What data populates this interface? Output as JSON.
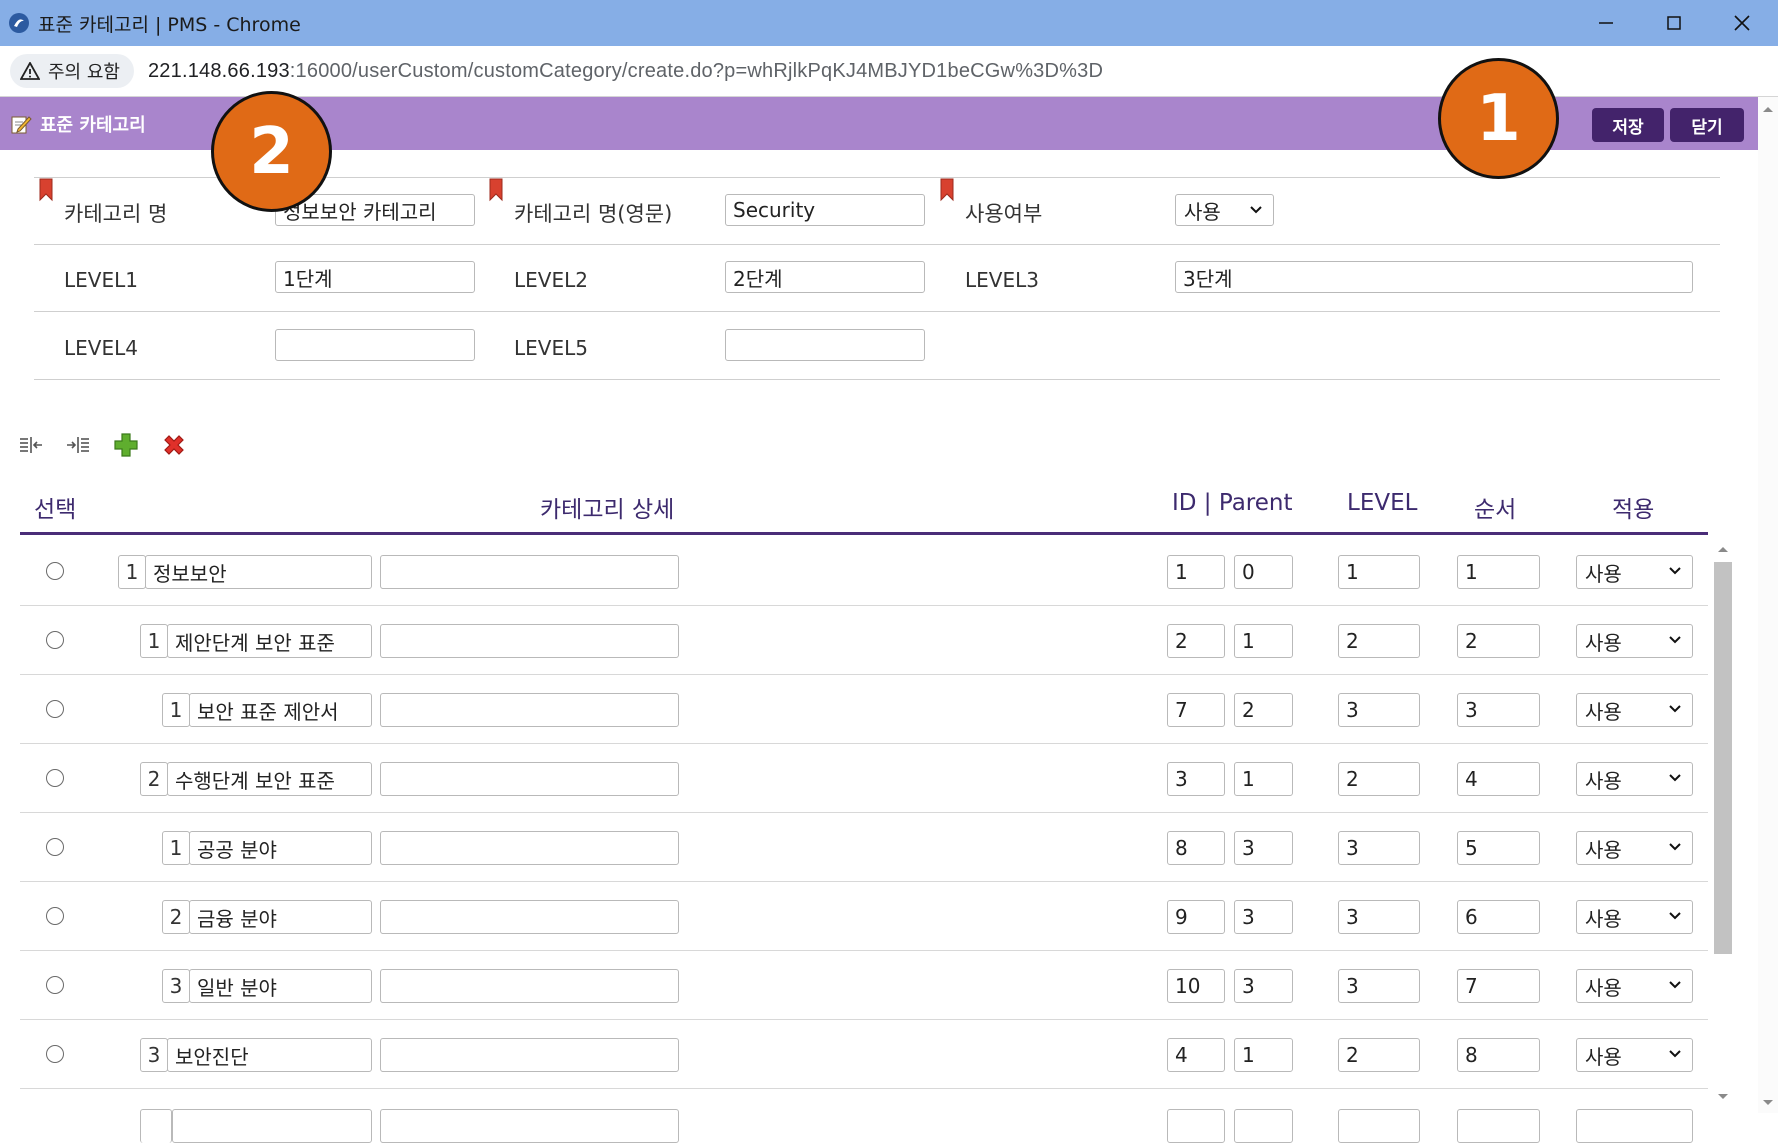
{
  "window": {
    "title": "표준 카테고리 | PMS - Chrome",
    "controls": [
      "minimize-icon",
      "maximize-icon",
      "close-icon"
    ]
  },
  "address_bar": {
    "warning_label": "주의 요함",
    "url_host": "221.148.66.193",
    "url_rest": ":16000/userCustom/customCategory/create.do?p=whRjlkPqKJ4MBJYD1beCGw%3D%3D"
  },
  "header": {
    "title": "표준 카테고리",
    "save_label": "저장",
    "close_label": "닫기",
    "color": "#a985cc",
    "button_color": "#43236b"
  },
  "form": {
    "category_name_label": "카테고리 명",
    "category_name_value": "정보보안 카테고리",
    "category_name_en_label": "카테고리 명(영문)",
    "category_name_en_value": "Security",
    "use_label": "사용여부",
    "use_value": "사용",
    "level1_label": "LEVEL1",
    "level1_value": "1단계",
    "level2_label": "LEVEL2",
    "level2_value": "2단계",
    "level3_label": "LEVEL3",
    "level3_value": "3단계",
    "level4_label": "LEVEL4",
    "level4_value": "",
    "level5_label": "LEVEL5",
    "level5_value": ""
  },
  "toolbar": {
    "items": [
      "outdent-icon",
      "indent-icon",
      "add-icon",
      "delete-icon"
    ]
  },
  "table": {
    "columns": {
      "select": "선택",
      "detail": "카테고리 상세",
      "id_parent": "ID | Parent",
      "level": "LEVEL",
      "order": "순서",
      "apply": "적용"
    },
    "rows": [
      {
        "seq": "1",
        "name": "정보보안",
        "desc": "",
        "id": "1",
        "parent": "0",
        "level": "1",
        "order": "1",
        "apply": "사용"
      },
      {
        "seq": "1",
        "name": "제안단계 보안 표준",
        "desc": "",
        "id": "2",
        "parent": "1",
        "level": "2",
        "order": "2",
        "apply": "사용"
      },
      {
        "seq": "1",
        "name": "보안 표준 제안서",
        "desc": "",
        "id": "7",
        "parent": "2",
        "level": "3",
        "order": "3",
        "apply": "사용"
      },
      {
        "seq": "2",
        "name": "수행단계 보안 표준",
        "desc": "",
        "id": "3",
        "parent": "1",
        "level": "2",
        "order": "4",
        "apply": "사용"
      },
      {
        "seq": "1",
        "name": "공공 분야",
        "desc": "",
        "id": "8",
        "parent": "3",
        "level": "3",
        "order": "5",
        "apply": "사용"
      },
      {
        "seq": "2",
        "name": "금융 분야",
        "desc": "",
        "id": "9",
        "parent": "3",
        "level": "3",
        "order": "6",
        "apply": "사용"
      },
      {
        "seq": "3",
        "name": "일반 분야",
        "desc": "",
        "id": "10",
        "parent": "3",
        "level": "3",
        "order": "7",
        "apply": "사용"
      },
      {
        "seq": "3",
        "name": "보안진단",
        "desc": "",
        "id": "4",
        "parent": "1",
        "level": "2",
        "order": "8",
        "apply": "사용"
      }
    ]
  },
  "callouts": {
    "one": "1",
    "two": "2",
    "color": "#e06a16"
  }
}
